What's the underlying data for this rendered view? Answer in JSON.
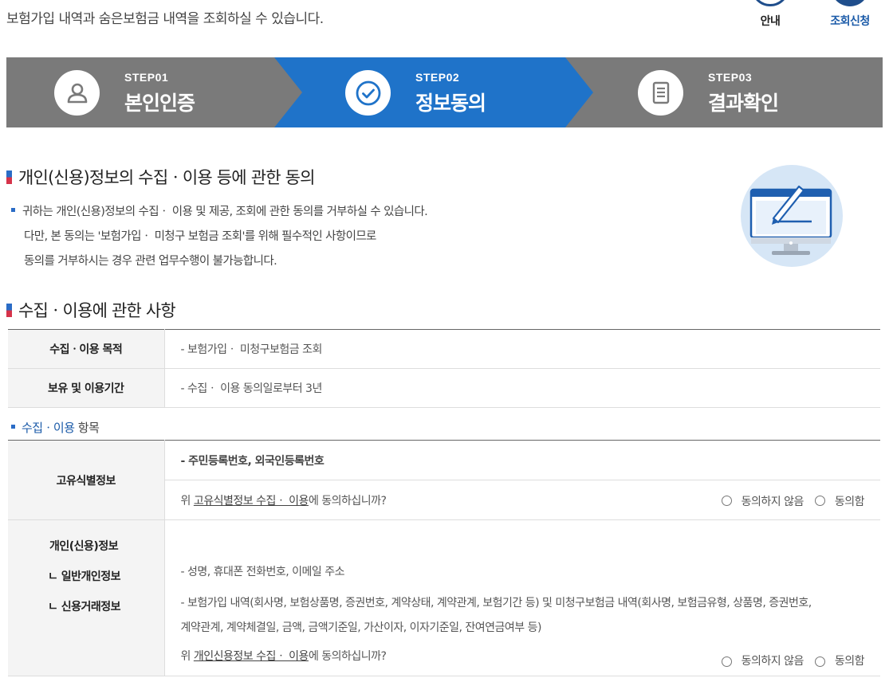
{
  "header": {
    "intro": "보험가입 내역과 숨은보험금 내역을 조회하실 수 있습니다.",
    "links": [
      {
        "label": "안내"
      },
      {
        "label": "조회신청"
      }
    ]
  },
  "steps": [
    {
      "num": "STEP01",
      "name": "본인인증",
      "icon": "person-icon",
      "active": false
    },
    {
      "num": "STEP02",
      "name": "정보동의",
      "icon": "check-circle-icon",
      "active": true
    },
    {
      "num": "STEP03",
      "name": "결과확인",
      "icon": "document-icon",
      "active": false
    }
  ],
  "consent": {
    "title": "개인(신용)정보의 수집ㆍ이용 등에 관한 동의",
    "notice": [
      "귀하는 개인(신용)정보의 수집ㆍ 이용 및 제공, 조회에 관한 동의를 거부하실 수 있습니다.",
      "다만, 본 동의는 '보험가입ㆍ 미청구 보험금 조회'를 위해 필수적인 사항이므로",
      "동의를 거부하시는 경우 관련 업무수행이 불가능합니다."
    ]
  },
  "collection": {
    "title": "수집ㆍ이용에 관한 사항",
    "rows": [
      {
        "label": "수집ㆍ이용 목적",
        "value": "- 보험가입ㆍ 미청구보험금 조회"
      },
      {
        "label": "보유 및 이용기간",
        "value": "- 수집ㆍ 이용 동의일로부터 3년"
      }
    ]
  },
  "items": {
    "heading_blue": "수집ㆍ이용",
    "heading_rest": " 항목",
    "unique": {
      "label": "고유식별정보",
      "value": "- 주민등록번호, 외국인등록번호",
      "question_prefix": "위 ",
      "question_link": "고유식별정보 수집ㆍ 이용",
      "question_suffix": "에 동의하십니까?"
    },
    "personal": {
      "label": "개인(신용)정보",
      "sub1": "ㄴ 일반개인정보",
      "sub2": "ㄴ 신용거래정보",
      "value1": "- 성명, 휴대폰 전화번호, 이메일 주소",
      "value2_line1": "- 보험가입 내역(회사명, 보험상품명, 증권번호, 계약상태, 계약관계, 보험기간 등) 및 미청구보험금 내역(회사명, 보험금유형, 상품명, 증권번호,",
      "value2_line2": "계약관계, 계약체결일, 금액, 금액기준일, 가산이자, 이자기준일, 잔여연금여부 등)",
      "question_prefix": "위 ",
      "question_link": "개인신용정보 수집ㆍ 이용",
      "question_suffix": "에 동의하십니까?"
    },
    "options": {
      "disagree": "동의하지 않음",
      "agree": "동의함"
    }
  },
  "colors": {
    "step_active": "#1f73c9",
    "step_inactive": "#7a7a7a",
    "accent_blue": "#1a5aa8",
    "accent_red": "#d6334a"
  }
}
